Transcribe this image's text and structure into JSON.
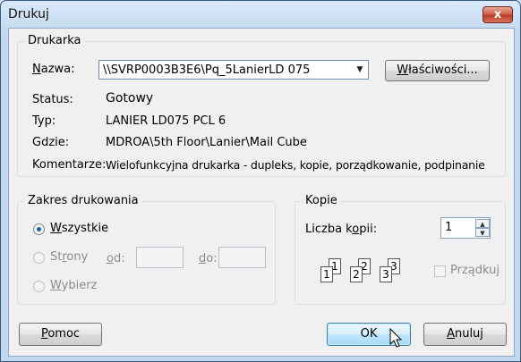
{
  "window": {
    "title": "Drukuj",
    "close_symbol": "x"
  },
  "printer": {
    "group_label": "Drukarka",
    "name_label": "Nazwa:",
    "name_value": "\\\\SVRP0003B3E6\\Pq_5LanierLD 075",
    "properties_button": "Właściwości...",
    "status_label": "Status:",
    "status_value": "Gotowy",
    "type_label": "Typ:",
    "type_value": "LANIER LD075 PCL 6",
    "where_label": "Gdzie:",
    "where_value": "MDROA\\5th Floor\\Lanier\\Mail Cube",
    "comment_label": "Komentarze:",
    "comment_value": "Wielofunkcyjna drukarka - dupleks, kopie, porządkowanie, podpinanie"
  },
  "range": {
    "group_label": "Zakres drukowania",
    "all": "Wszystkie",
    "pages": "Strony",
    "from_label": "od:",
    "to_label": "do:",
    "selection": "Wybierz",
    "selected": "all"
  },
  "copies": {
    "group_label": "Kopie",
    "count_label": "Liczba kopii:",
    "count_value": "1",
    "collate_label": "Prządkuj",
    "collate_checked": false,
    "collate_pages": [
      "1",
      "1",
      "2",
      "2",
      "3",
      "3"
    ]
  },
  "buttons": {
    "help": "Pomoc",
    "ok": "OK",
    "cancel": "Anuluj"
  }
}
